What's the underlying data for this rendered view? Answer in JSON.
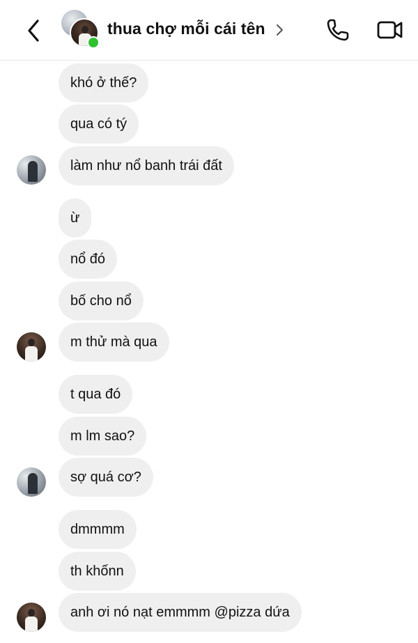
{
  "header": {
    "title": "thua chợ mỗi cái tên",
    "back_icon": "chevron-left-icon",
    "title_chevron_icon": "chevron-right-icon",
    "call_icon": "phone-icon",
    "video_icon": "video-camera-icon",
    "online_color": "#2fc12f"
  },
  "messages": [
    {
      "text": "khó ở thế?"
    },
    {
      "text": "qua có tý"
    },
    {
      "text": "làm như nổ banh trái đất",
      "avatar": "gray"
    },
    {
      "text": "ừ"
    },
    {
      "text": "nổ đó"
    },
    {
      "text": "bố cho nổ"
    },
    {
      "text": "m thử mà qua",
      "avatar": "brown"
    },
    {
      "text": "t qua đó"
    },
    {
      "text": "m lm sao?"
    },
    {
      "text": "sợ quá cơ?",
      "avatar": "gray"
    },
    {
      "text": "dmmmm"
    },
    {
      "text": "th khốnn"
    },
    {
      "text": "anh ơi nó nạt emmmm @pizza dứa",
      "avatar": "brown"
    }
  ],
  "colors": {
    "bubble_bg": "#efefef",
    "text": "#111111",
    "background": "#ffffff"
  }
}
